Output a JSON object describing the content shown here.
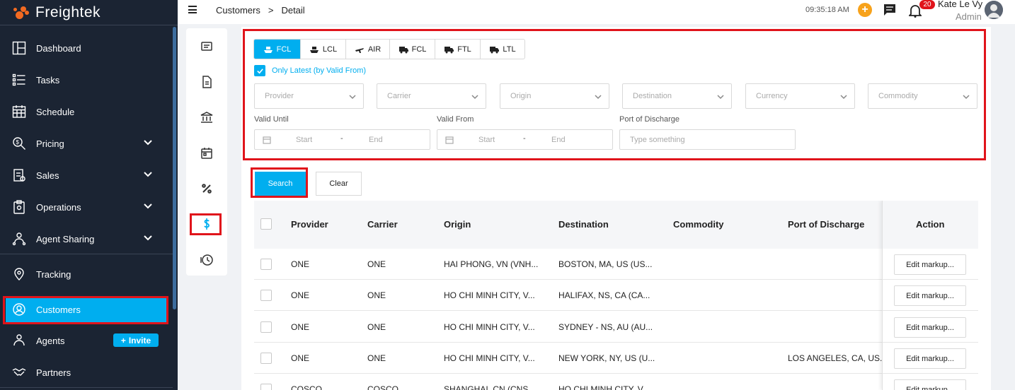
{
  "brand": {
    "name": "Freightek"
  },
  "sidebar": {
    "items": [
      {
        "label": "Dashboard",
        "icon": "dashboard-icon"
      },
      {
        "label": "Tasks",
        "icon": "tasks-icon"
      },
      {
        "label": "Schedule",
        "icon": "calendar-icon"
      },
      {
        "label": "Pricing",
        "icon": "pricing-icon",
        "expandable": true
      },
      {
        "label": "Sales",
        "icon": "sales-icon",
        "expandable": true
      },
      {
        "label": "Operations",
        "icon": "operations-icon",
        "expandable": true
      },
      {
        "label": "Agent Sharing",
        "icon": "agent-sharing-icon",
        "expandable": true
      },
      {
        "label": "Tracking",
        "icon": "tracking-icon"
      },
      {
        "label": "Customers",
        "icon": "customers-icon",
        "active": true
      },
      {
        "label": "Agents",
        "icon": "agents-icon"
      },
      {
        "label": "Partners",
        "icon": "partners-icon"
      }
    ],
    "invite_label": "Invite"
  },
  "topbar": {
    "breadcrumb": [
      "Customers",
      ">",
      "Detail"
    ],
    "time": "09:35:18 AM",
    "notification_count": "20",
    "user_name": "Kate Le Vy",
    "user_role": "Admin"
  },
  "filters": {
    "tabs": [
      {
        "label": "FCL",
        "icon": "ship-icon",
        "active": true
      },
      {
        "label": "LCL",
        "icon": "ship-icon"
      },
      {
        "label": "AIR",
        "icon": "plane-icon"
      },
      {
        "label": "FCL",
        "icon": "truck-icon"
      },
      {
        "label": "FTL",
        "icon": "truck-icon"
      },
      {
        "label": "LTL",
        "icon": "truck-icon"
      }
    ],
    "only_latest_label": "Only Latest (by Valid From)",
    "only_latest_checked": true,
    "selects": [
      "Provider",
      "Carrier",
      "Origin",
      "Destination",
      "Currency",
      "Commodity"
    ],
    "valid_until_label": "Valid Until",
    "valid_from_label": "Valid From",
    "port_label": "Port of Discharge",
    "start_placeholder": "Start",
    "end_placeholder": "End",
    "port_placeholder": "Type something",
    "search_label": "Search",
    "clear_label": "Clear"
  },
  "table": {
    "columns": [
      "Provider",
      "Carrier",
      "Origin",
      "Destination",
      "Commodity",
      "Port of Discharge",
      "Action"
    ],
    "rows": [
      {
        "provider": "ONE",
        "carrier": "ONE",
        "origin": "HAI PHONG, VN (VNH...",
        "destination": "BOSTON, MA, US (US...",
        "commodity": "",
        "port": ""
      },
      {
        "provider": "ONE",
        "carrier": "ONE",
        "origin": "HO CHI MINH CITY, V...",
        "destination": "HALIFAX, NS, CA (CA...",
        "commodity": "",
        "port": ""
      },
      {
        "provider": "ONE",
        "carrier": "ONE",
        "origin": "HO CHI MINH CITY, V...",
        "destination": "SYDNEY - NS, AU (AU...",
        "commodity": "",
        "port": ""
      },
      {
        "provider": "ONE",
        "carrier": "ONE",
        "origin": "HO CHI MINH CITY, V...",
        "destination": "NEW YORK, NY, US (U...",
        "commodity": "",
        "port": "LOS ANGELES, CA, US..."
      },
      {
        "provider": "COSCO",
        "carrier": "COSCO",
        "origin": "SHANGHAI, CN (CNS...",
        "destination": "HO CHI MINH CITY, V...",
        "commodity": "",
        "port": ""
      }
    ],
    "edit_label": "Edit markup..."
  }
}
